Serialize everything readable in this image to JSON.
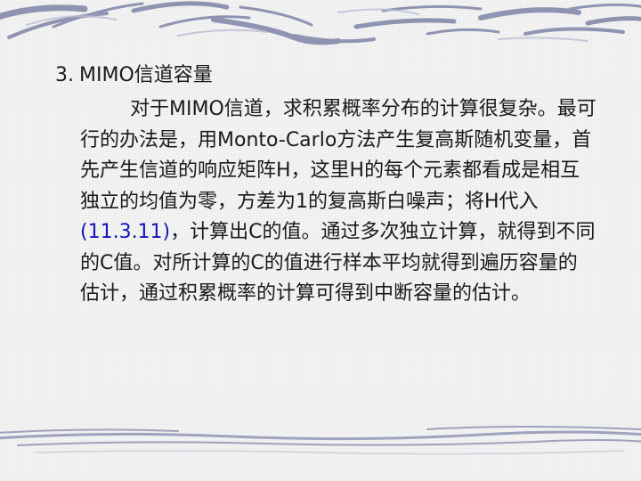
{
  "slide": {
    "title_number": "3.",
    "title_text": "MIMO信道容量",
    "paragraph": {
      "part1": "对于MIMO信道，求积累概率分布的计算很复杂。最可行的办法是，用Monto-Carlo方法产生复高斯随机变量，首先产生信道的响应矩阵H，这里H的每个元素都看成是相互独立的均值为零，方差为1的复高斯白噪声；将H代入",
      "ref": "(11.3.11)",
      "part2": "，计算出C的值。通过多次独立计算，就得到不同的C值。对所计算的C的值进行样本平均就得到遍历容量的估计，通过积累概率的计算可得到中断容量的估计。"
    }
  },
  "colors": {
    "text": "#1a1a1a",
    "reference": "#1515b8",
    "decoration": "#8a8fb0",
    "background": "#f3f3f3"
  }
}
